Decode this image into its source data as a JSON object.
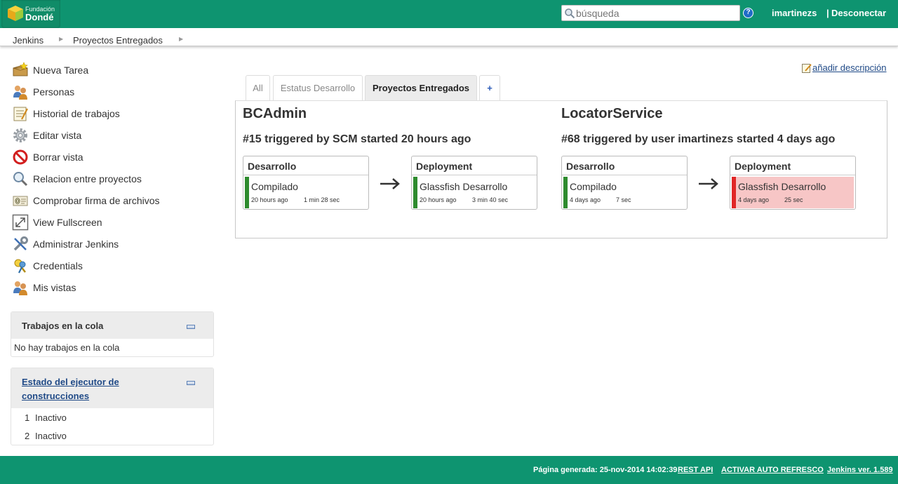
{
  "header": {
    "logo_line1": "Fundación",
    "logo_line2": "Dondé",
    "search_placeholder": "búsqueda",
    "help": "?",
    "user": "imartinezs",
    "logout_sep": "|",
    "logout": "Desconectar",
    "bg_color": "#0e9470"
  },
  "breadcrumbs": [
    {
      "label": "Jenkins"
    },
    {
      "label": "Proyectos Entregados"
    }
  ],
  "tasks": [
    {
      "label": "Nueva Tarea",
      "icon": "new-package-icon"
    },
    {
      "label": "Personas",
      "icon": "user-group-icon"
    },
    {
      "label": "Historial de trabajos",
      "icon": "notepad-icon"
    },
    {
      "label": "Editar vista",
      "icon": "gear-icon"
    },
    {
      "label": "Borrar vista",
      "icon": "no-entry-icon"
    },
    {
      "label": "Relacion entre proyectos",
      "icon": "magnifier-icon"
    },
    {
      "label": "Comprobar firma de archivos",
      "icon": "fingerprint-icon"
    },
    {
      "label": "View Fullscreen",
      "icon": "fullscreen-icon"
    },
    {
      "label": "Administrar Jenkins",
      "icon": "wrench-icon"
    },
    {
      "label": "Credentials",
      "icon": "keys-icon"
    },
    {
      "label": "Mis vistas",
      "icon": "user-group-icon"
    }
  ],
  "queue": {
    "title": "Trabajos en la cola",
    "empty": "No hay trabajos en la cola"
  },
  "executors": {
    "title_line1": "Estado del ejecutor de",
    "title_line2": "construcciones",
    "items": [
      {
        "num": "1",
        "status": "Inactivo"
      },
      {
        "num": "2",
        "status": "Inactivo"
      }
    ]
  },
  "tabs": [
    {
      "label": "All"
    },
    {
      "label": "Estatus Desarrollo"
    },
    {
      "label": "Proyectos Entregados",
      "active": true
    },
    {
      "label": "+"
    }
  ],
  "add_description": "añadir descripción",
  "pipelines": [
    {
      "name": "BCAdmin",
      "trigger": "#15 triggered by SCM started 20 hours ago",
      "stages": [
        {
          "title": "Desarrollo",
          "build": "Compilado",
          "when": "20 hours ago",
          "duration": "1 min 28 sec",
          "status": "success"
        },
        {
          "title": "Deployment",
          "build": "Glassfish Desarrollo",
          "when": "20 hours ago",
          "duration": "3 min 40 sec",
          "status": "success"
        }
      ]
    },
    {
      "name": "LocatorService",
      "trigger": "#68 triggered by user imartinezs started 4 days ago",
      "stages": [
        {
          "title": "Desarrollo",
          "build": "Compilado",
          "when": "4 days ago",
          "duration": "7 sec",
          "status": "success"
        },
        {
          "title": "Deployment",
          "build": "Glassfish Desarrollo",
          "when": "4 days ago",
          "duration": "25 sec",
          "status": "failed"
        }
      ]
    }
  ],
  "colors": {
    "success": "#2e8b2e",
    "failed": "#e02727",
    "failed_bg": "#f7c6c6"
  },
  "footer": {
    "generated": "Página generada: 25-nov-2014 14:02:39",
    "rest_api": "REST API",
    "auto_refresh": "ACTIVAR AUTO REFRESCO",
    "version": "Jenkins ver. 1.589"
  }
}
